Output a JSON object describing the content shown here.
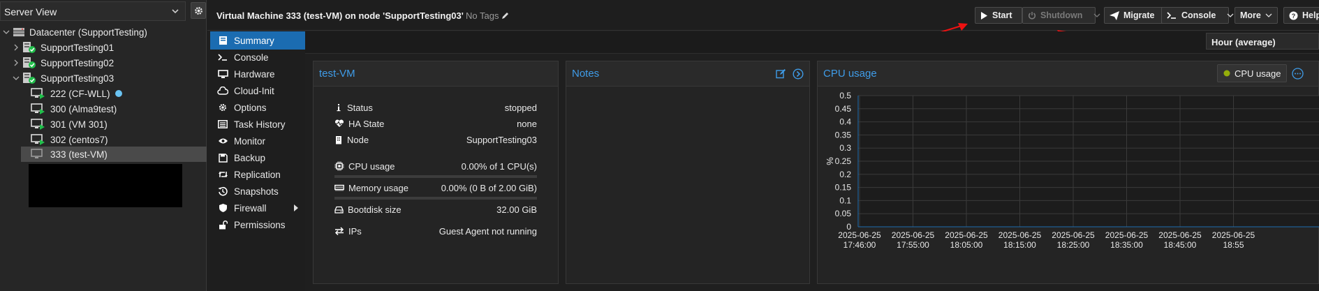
{
  "tree": {
    "view_label": "Server View",
    "nodes": [
      {
        "label": "Datacenter (SupportTesting)",
        "kind": "datacenter"
      },
      {
        "label": "SupportTesting01",
        "kind": "node"
      },
      {
        "label": "SupportTesting02",
        "kind": "node"
      },
      {
        "label": "SupportTesting03",
        "kind": "node"
      },
      {
        "label": "222 (CF-WLL)",
        "kind": "vm-running"
      },
      {
        "label": "300 (Alma9test)",
        "kind": "vm-running"
      },
      {
        "label": "301 (VM 301)",
        "kind": "vm-running"
      },
      {
        "label": "302 (centos7)",
        "kind": "vm-running"
      },
      {
        "label": "333 (test-VM)",
        "kind": "vm-stopped"
      }
    ]
  },
  "header": {
    "title": "Virtual Machine 333 (test-VM) on node 'SupportTesting03'",
    "tags": "No Tags",
    "buttons": {
      "start": "Start",
      "shutdown": "Shutdown",
      "migrate": "Migrate",
      "console": "Console",
      "more": "More",
      "help": "Help"
    }
  },
  "nav": {
    "items": [
      {
        "label": "Summary",
        "icon": "book-icon"
      },
      {
        "label": "Console",
        "icon": "terminal-icon"
      },
      {
        "label": "Hardware",
        "icon": "desktop-icon"
      },
      {
        "label": "Cloud-Init",
        "icon": "cloud-icon"
      },
      {
        "label": "Options",
        "icon": "gear-icon"
      },
      {
        "label": "Task History",
        "icon": "list-icon"
      },
      {
        "label": "Monitor",
        "icon": "eye-icon"
      },
      {
        "label": "Backup",
        "icon": "floppy-icon"
      },
      {
        "label": "Replication",
        "icon": "retweet-icon"
      },
      {
        "label": "Snapshots",
        "icon": "history-icon"
      },
      {
        "label": "Firewall",
        "icon": "shield-icon"
      },
      {
        "label": "Permissions",
        "icon": "unlock-icon"
      }
    ]
  },
  "timeframe": "Hour (average)",
  "status_panel": {
    "title": "test-VM",
    "rows": [
      {
        "label": "Status",
        "value": "stopped",
        "icon": "info-icon"
      },
      {
        "label": "HA State",
        "value": "none",
        "icon": "heartbeat-icon"
      },
      {
        "label": "Node",
        "value": "SupportTesting03",
        "icon": "building-icon"
      },
      {
        "label": "CPU usage",
        "value": "0.00% of 1 CPU(s)",
        "icon": "cpu-icon"
      },
      {
        "label": "Memory usage",
        "value": "0.00% (0 B of 2.00 GiB)",
        "icon": "memory-icon"
      },
      {
        "label": "Bootdisk size",
        "value": "32.00 GiB",
        "icon": "hdd-icon"
      },
      {
        "label": "IPs",
        "value": "Guest Agent not running",
        "icon": "exchange-icon"
      }
    ],
    "cpu_fraction": 0,
    "mem_fraction": 0
  },
  "notes_panel": {
    "title": "Notes"
  },
  "cpu_panel": {
    "title": "CPU usage",
    "legend": "CPU usage"
  },
  "colors": {
    "accent": "#3f9ce8",
    "active_nav": "#1b6cb1",
    "running_green": "#21bf4b",
    "legend_dot": "#94ae0a"
  },
  "chart_data": {
    "type": "line",
    "title": "CPU usage",
    "ylabel": "%",
    "ylim": [
      0,
      0.5
    ],
    "yticks": [
      "0.5",
      "0.45",
      "0.4",
      "0.35",
      "0.3",
      "0.25",
      "0.2",
      "0.15",
      "0.1",
      "0.05",
      "0"
    ],
    "x": [
      [
        "2025-06-25",
        "17:46:00"
      ],
      [
        "2025-06-25",
        "17:55:00"
      ],
      [
        "2025-06-25",
        "18:05:00"
      ],
      [
        "2025-06-25",
        "18:15:00"
      ],
      [
        "2025-06-25",
        "18:25:00"
      ],
      [
        "2025-06-25",
        "18:35:00"
      ],
      [
        "2025-06-25",
        "18:45:00"
      ],
      [
        "2025-06-25",
        "18:55"
      ]
    ],
    "series": [
      {
        "name": "CPU usage",
        "values": []
      }
    ],
    "grid": true,
    "legend": "top-right"
  }
}
